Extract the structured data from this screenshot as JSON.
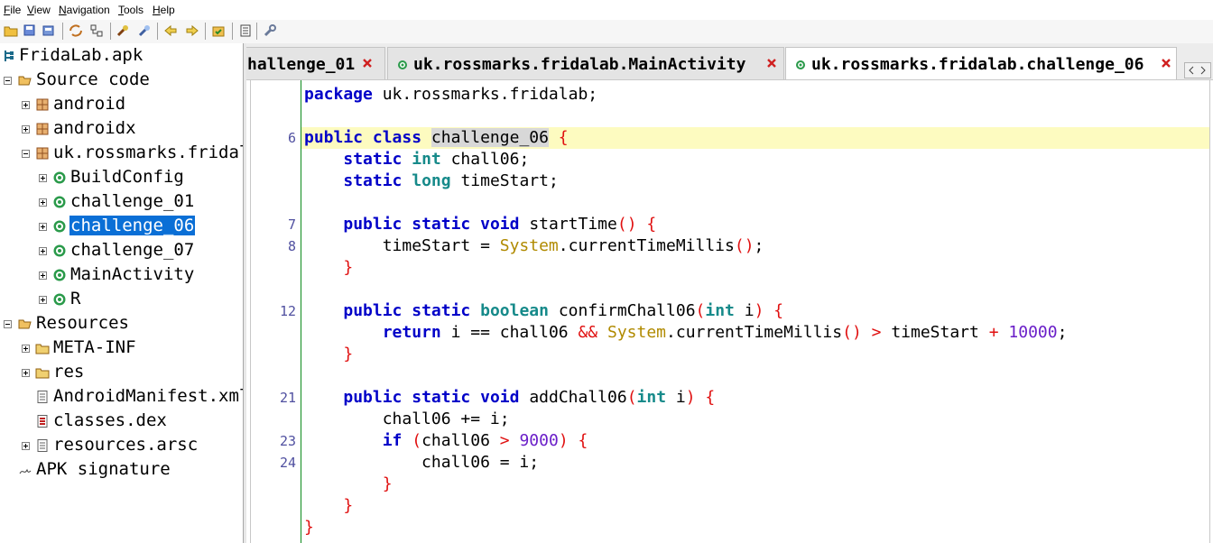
{
  "menu": {
    "file": {
      "u": "F",
      "rest": "ile"
    },
    "view": {
      "u": "V",
      "rest": "iew"
    },
    "navigation": {
      "u": "N",
      "rest": "avigation"
    },
    "tools": {
      "u": "T",
      "rest": "ools"
    },
    "help": {
      "u": "H",
      "rest": "elp"
    }
  },
  "tree": {
    "root": "FridaLab.apk",
    "source_code": "Source code",
    "pkg_android": "android",
    "pkg_androidx": "androidx",
    "pkg_app": "uk.rossmarks.fridalab",
    "classes": [
      "BuildConfig",
      "challenge_01",
      "challenge_06",
      "challenge_07",
      "MainActivity",
      "R"
    ],
    "selected_class": "challenge_06",
    "resources": "Resources",
    "meta_inf": "META-INF",
    "res": "res",
    "manifest": "AndroidManifest.xml",
    "classes_dex": "classes.dex",
    "resources_arsc": "resources.arsc",
    "apk_signature": "APK signature"
  },
  "tabs": [
    {
      "label": "hallenge_01",
      "active": false
    },
    {
      "label": "uk.rossmarks.fridalab.MainActivity",
      "active": false
    },
    {
      "label": "uk.rossmarks.fridalab.challenge_06",
      "active": true
    }
  ],
  "code": {
    "line_numbers": [
      "6",
      "7",
      "8",
      "12",
      "21",
      "23",
      "24"
    ],
    "package_name": "uk.rossmarks.fridalab;",
    "class_name": "challenge_06",
    "field1": "chall06;",
    "field2": "timeStart;",
    "m1_name": "startTime",
    "m1_body_a": "timeStart = ",
    "m1_body_cls": "System",
    "m1_body_b": ".currentTimeMillis",
    "m2_name": "confirmChall06",
    "m2_param": "i",
    "m2_ret_a": "i == chall06 ",
    "m2_ret_b": ".currentTimeMillis",
    "m2_ret_c": "timeStart ",
    "m2_ret_num": "10000",
    "m3_name": "addChall06",
    "m3_param": "i",
    "m3_body1": "chall06 += i;",
    "m3_if_var": "chall06 ",
    "m3_if_num": "9000",
    "m3_assign": "chall06 = i;",
    "kw": {
      "package": "package",
      "public": "public",
      "class": "class",
      "static": "static",
      "int": "int",
      "long": "long",
      "void": "void",
      "boolean": "boolean",
      "return": "return",
      "if": "if"
    }
  },
  "colors": {
    "selection": "#0a6fd6",
    "keyword": "#0000c8",
    "type": "#168a8a",
    "highlight_line": "#fdfbc0",
    "brace": "#e01010",
    "number": "#6a1ec8",
    "class_ref": "#b08a00"
  }
}
